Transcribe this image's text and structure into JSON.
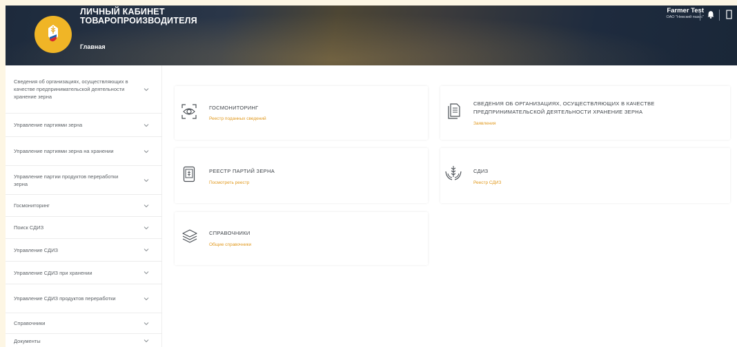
{
  "header": {
    "title_line1": "ЛИЧНЫЙ КАБИНЕТ",
    "title_line2": "ТОВАРОПРОИЗВОДИТЕЛЯ",
    "nav_home": "Главная",
    "user_name": "Farmer Test",
    "user_org": "ОАО \"Невский пазис\"",
    "icons": [
      "emblem-icon",
      "bell-icon",
      "logout-icon"
    ]
  },
  "sidebar": {
    "items": [
      {
        "label": "Сведения об организациях, осуществляющих в качестве предпринимательской деятельности хранение зерна"
      },
      {
        "label": "Управление партиями зерна"
      },
      {
        "label": "Управление партиями зерна на хранении"
      },
      {
        "label": "Управление партии продуктов переработки зерна"
      },
      {
        "label": "Госмониторинг"
      },
      {
        "label": "Поиск СДИЗ"
      },
      {
        "label": "Управление СДИЗ"
      },
      {
        "label": "Управление СДИЗ при хранении"
      },
      {
        "label": "Управление СДИЗ продуктов переработки"
      },
      {
        "label": "Справочники"
      },
      {
        "label": "Документы"
      }
    ]
  },
  "cards": {
    "gosmonitoring": {
      "title": "ГОСМОНИТОРИНГ",
      "link": "Реестр поданных сведений",
      "icon": "eye-scan-icon"
    },
    "organizations": {
      "title": "СВЕДЕНИЯ ОБ ОРГАНИЗАЦИЯХ, ОСУЩЕСТВЛЯЮЩИХ В КАЧЕСТВЕ ПРЕДПРИНИМАТЕЛЬСКОЙ ДЕЯТЕЛЬНОСТИ ХРАНЕНИЕ ЗЕРНА",
      "link": "Заявления",
      "icon": "documents-icon"
    },
    "grain_registry": {
      "title": "РЕЕСТР ПАРТИЙ ЗЕРНА",
      "link": "Посмотреть реестр",
      "icon": "grain-box-icon"
    },
    "sdiz": {
      "title": "СДИЗ",
      "link": "Реестр СДИЗ",
      "icon": "wheat-hands-icon"
    },
    "directories": {
      "title": "СПРАВОЧНИКИ",
      "link": "Общие справочники",
      "icon": "layers-icon"
    }
  },
  "colors": {
    "accent": "#e19a20",
    "logo": "#f0b526",
    "header": "#1d2a3c"
  }
}
